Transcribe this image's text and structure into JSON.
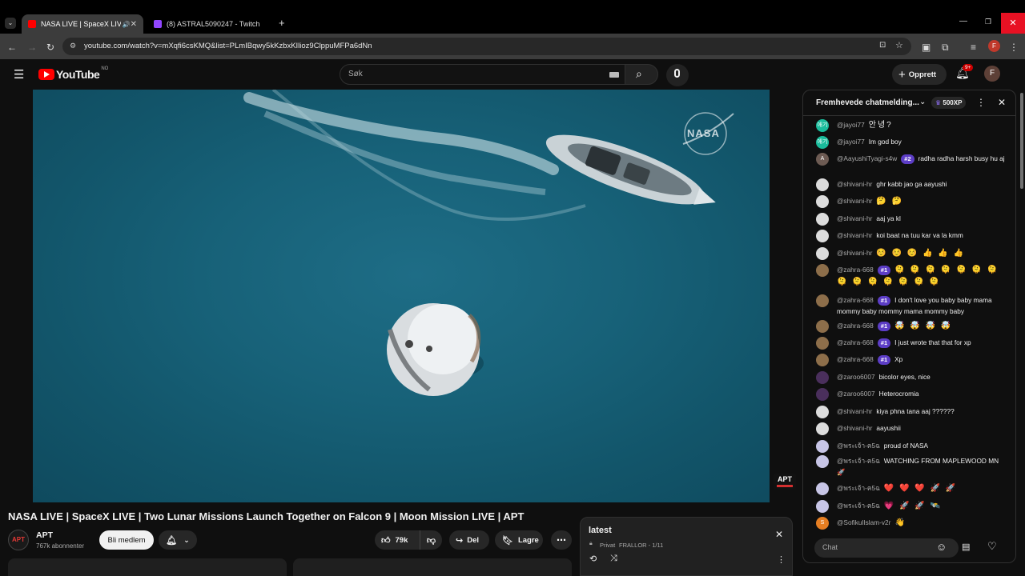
{
  "browser": {
    "tabs": [
      {
        "title": "NASA LIVE | SpaceX LIVE | T"
      },
      {
        "title": "(8) ASTRAL5090247 - Twitch"
      }
    ],
    "url": "youtube.com/watch?v=mXqfi6csKMQ&list=PLmIBqwy5kKzbxKIlioz9ClppuMFPa6dNn"
  },
  "youtube": {
    "logo_text": "YouTube",
    "region": "NO",
    "search_placeholder": "Søk",
    "create_label": "Opprett",
    "notif_count": "9+",
    "avatar_letter": "F"
  },
  "video": {
    "watermark": "NASA",
    "corner_logo": "APT",
    "title": "NASA LIVE | SpaceX LIVE | Two Lunar Missions Launch Together on Falcon 9 | Moon Mission LIVE | APT"
  },
  "channel": {
    "name": "APT",
    "avatar_text": "APT",
    "subscribers": "767k abonnenter",
    "join_label": "Bli medlem"
  },
  "actions": {
    "likes": "79k",
    "share": "Del",
    "save": "Lagre"
  },
  "playlist": {
    "title": "latest",
    "privacy": "Privat",
    "meta": "FRALLOR - 1/11"
  },
  "chat": {
    "header": "Fremhevede chatmelding...",
    "xp": "500XP",
    "input_placeholder": "Chat",
    "messages": [
      {
        "user": "@jayoi77",
        "avatar": "애기",
        "text": "안녕?"
      },
      {
        "user": "@jayoi77",
        "avatar": "애기",
        "text": "Im god boy"
      },
      {
        "user": "@AayushiTyagi-s4w",
        "avatar": "A",
        "badge": "#2",
        "text": "radha radha harsh busy hu aj"
      },
      {
        "user": "@shivani-hr",
        "text": "ghr kabb jao ga aayushi"
      },
      {
        "user": "@shivani-hr",
        "text": "🤔 🤔"
      },
      {
        "user": "@shivani-hr",
        "text": "aaj ya kl"
      },
      {
        "user": "@shivani-hr",
        "text": "koi baat na tuu kar va la kmm"
      },
      {
        "user": "@shivani-hr",
        "text": "☺️ ☺️ ☺️ 👍 👍 👍"
      },
      {
        "user": "@zahra-668",
        "badge": "#1",
        "text": "🫠 🫠 🫠 🫠 🫠 🫠 🫠 🫠 🫠 🫠 🫠 🫠 🫠 🫠"
      },
      {
        "user": "@zahra-668",
        "badge": "#1",
        "text": "I don't love you baby baby mama mommy baby mommy mama mommy baby"
      },
      {
        "user": "@zahra-668",
        "badge": "#1",
        "text": "🤯 🤯 🤯 🤯"
      },
      {
        "user": "@zahra-668",
        "badge": "#1",
        "text": "I just wrote that that for xp"
      },
      {
        "user": "@zahra-668",
        "badge": "#1",
        "text": "Xp"
      },
      {
        "user": "@zaroo6007",
        "text": "bicolor eyes, nice"
      },
      {
        "user": "@zaroo6007",
        "text": "Heterocromia"
      },
      {
        "user": "@shivani-hr",
        "text": "kiya phna tana aaj ??????"
      },
      {
        "user": "@shivani-hr",
        "text": "aayushii"
      },
      {
        "user": "@พระเจ้า-ค5ฉ",
        "text": "proud of NASA"
      },
      {
        "user": "@พระเจ้า-ค5ฉ",
        "text": "WATCHING FROM MAPLEWOOD MN 🚀"
      },
      {
        "user": "@พระเจ้า-ค5ฉ",
        "text": "❤️ ❤️ ❤️ 🚀 🚀"
      },
      {
        "user": "@พระเจ้า-ค5ฉ",
        "text": "💗 🚀 🚀 🛰️"
      },
      {
        "user": "@SofikulIslam-v2r",
        "avatar": "S",
        "text": "👋"
      }
    ]
  },
  "colors": {
    "accent_red": "#ff0000",
    "badge_purple": "#5c3dc6",
    "ocean": "#176178"
  }
}
